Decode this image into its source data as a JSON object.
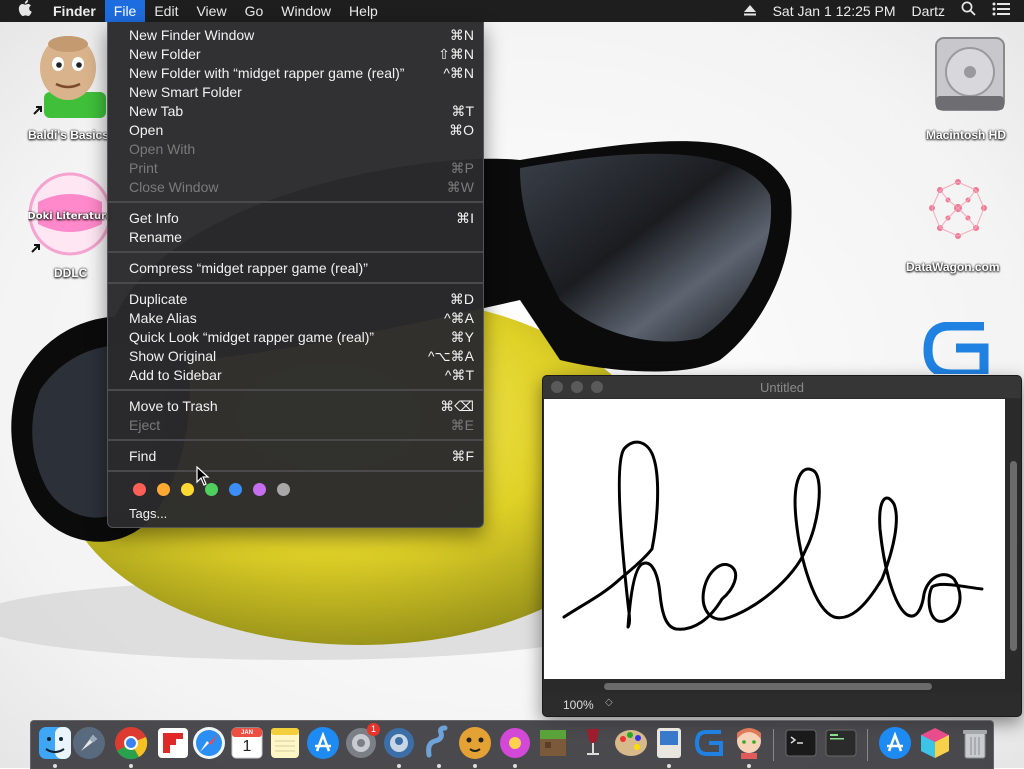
{
  "menubar": {
    "app_name": "Finder",
    "menus": [
      "File",
      "Edit",
      "View",
      "Go",
      "Window",
      "Help"
    ],
    "clock": "Sat Jan 1  12:25 PM",
    "user": "Dartz",
    "icons": [
      "apple-icon",
      "eject-icon",
      "spotlight-search-icon",
      "notification-center-icon"
    ]
  },
  "desktop": {
    "icons": [
      {
        "label": "Baldi's Basics",
        "icon": "baldi-app-icon"
      },
      {
        "label": "DDLC",
        "icon": "ddlc-app-icon",
        "icon_text": "Doki Doki Literature Club"
      },
      {
        "label": "Macintosh HD",
        "icon": "hard-drive-icon"
      },
      {
        "label": "DataWagon.com",
        "icon": "datawagon-icon"
      }
    ]
  },
  "file_menu": {
    "items": [
      {
        "label": "New Finder Window",
        "shortcut": "⌘N",
        "enabled": true
      },
      {
        "label": "New Folder",
        "shortcut": "⇧⌘N",
        "enabled": true
      },
      {
        "label": "New Folder with “midget rapper game (real)”",
        "shortcut": "^⌘N",
        "enabled": true
      },
      {
        "label": "New Smart Folder",
        "shortcut": "",
        "enabled": true
      },
      {
        "label": "New Tab",
        "shortcut": "⌘T",
        "enabled": true
      },
      {
        "label": "Open",
        "shortcut": "⌘O",
        "enabled": true
      },
      {
        "label": "Open With",
        "shortcut": "",
        "enabled": false
      },
      {
        "label": "Print",
        "shortcut": "⌘P",
        "enabled": false
      },
      {
        "label": "Close Window",
        "shortcut": "⌘W",
        "enabled": false
      },
      {
        "label": "Get Info",
        "shortcut": "⌘I",
        "enabled": true
      },
      {
        "label": "Rename",
        "shortcut": "",
        "enabled": true
      },
      {
        "label": "Compress “midget rapper game (real)”",
        "shortcut": "",
        "enabled": true
      },
      {
        "label": "Duplicate",
        "shortcut": "⌘D",
        "enabled": true
      },
      {
        "label": "Make Alias",
        "shortcut": "^⌘A",
        "enabled": true
      },
      {
        "label": "Quick Look “midget rapper game (real)”",
        "shortcut": "⌘Y",
        "enabled": true
      },
      {
        "label": "Show Original",
        "shortcut": "^⌥⌘A",
        "enabled": true
      },
      {
        "label": "Add to Sidebar",
        "shortcut": "^⌘T",
        "enabled": true
      },
      {
        "label": "Move to Trash",
        "shortcut": "⌘⌫",
        "enabled": true
      },
      {
        "label": "Eject",
        "shortcut": "⌘E",
        "enabled": false
      },
      {
        "label": "Find",
        "shortcut": "⌘F",
        "enabled": true
      }
    ],
    "tag_colors": [
      "#ff5f57",
      "#ffa933",
      "#ffd932",
      "#4fd160",
      "#3a8ef6",
      "#c66ef0",
      "#a8a8a8"
    ],
    "tags_label": "Tags..."
  },
  "draw_window": {
    "title": "Untitled",
    "zoom": "100%",
    "drawn_text": "hello"
  },
  "dock": {
    "apps": [
      "finder-icon",
      "launchpad-icon",
      "chrome-icon",
      "flipboard-icon",
      "safari-icon",
      "calendar-icon",
      "notes-icon",
      "app-store-icon",
      "system-preferences-icon",
      "network-utility-icon",
      "worm-app-icon",
      "cheetah-app-icon",
      "flower-app-icon",
      "minecraft-icon",
      "wine-icon",
      "paint-palette-icon",
      "mac-app-icon",
      "gdevelop-icon",
      "anime-character-icon",
      "terminal-icon",
      "console-icon",
      "app-store-icon-2",
      "colorful-app-icon",
      "trash-icon"
    ],
    "calendar_month": "JAN",
    "calendar_day": "1",
    "badge_count": "1"
  }
}
